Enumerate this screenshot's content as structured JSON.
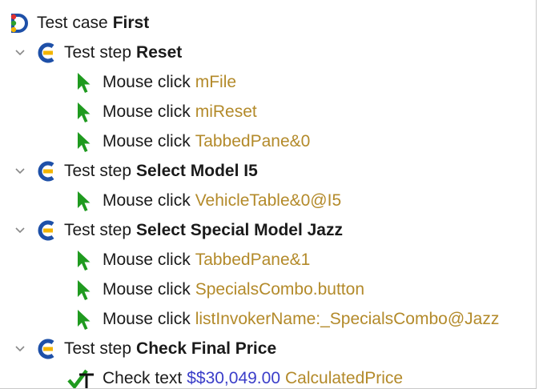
{
  "tree": {
    "root": {
      "type": "Test case",
      "name": "First",
      "icon": "test-case-icon"
    },
    "steps": [
      {
        "type": "Test step",
        "name": "Reset",
        "icon": "test-step-icon",
        "children": [
          {
            "action": "Mouse click",
            "target": "mFile",
            "icon": "mouse-click-icon"
          },
          {
            "action": "Mouse click",
            "target": "miReset",
            "icon": "mouse-click-icon"
          },
          {
            "action": "Mouse click",
            "target": "TabbedPane&0",
            "icon": "mouse-click-icon"
          }
        ]
      },
      {
        "type": "Test step",
        "name": "Select Model I5",
        "icon": "test-step-icon",
        "children": [
          {
            "action": "Mouse click",
            "target": "VehicleTable&0@I5",
            "icon": "mouse-click-icon"
          }
        ]
      },
      {
        "type": "Test step",
        "name": "Select Special Model Jazz",
        "icon": "test-step-icon",
        "children": [
          {
            "action": "Mouse click",
            "target": "TabbedPane&1",
            "icon": "mouse-click-icon"
          },
          {
            "action": "Mouse click",
            "target": "SpecialsCombo.button",
            "icon": "mouse-click-icon"
          },
          {
            "action": "Mouse click",
            "target": "listInvokerName:_SpecialsCombo@Jazz",
            "icon": "mouse-click-icon"
          }
        ]
      },
      {
        "type": "Test step",
        "name": "Check Final Price",
        "icon": "test-step-icon",
        "children": [
          {
            "action": "Check text",
            "value": "$$30,049.00",
            "target": "CalculatedPrice",
            "icon": "check-text-icon"
          }
        ]
      }
    ]
  },
  "colors": {
    "component": "#b38a2a",
    "value": "#3b3ec9",
    "mouse_icon": "#1f9a1f",
    "step_icon_blue": "#1e50a8",
    "step_icon_yellow": "#f2b400"
  }
}
